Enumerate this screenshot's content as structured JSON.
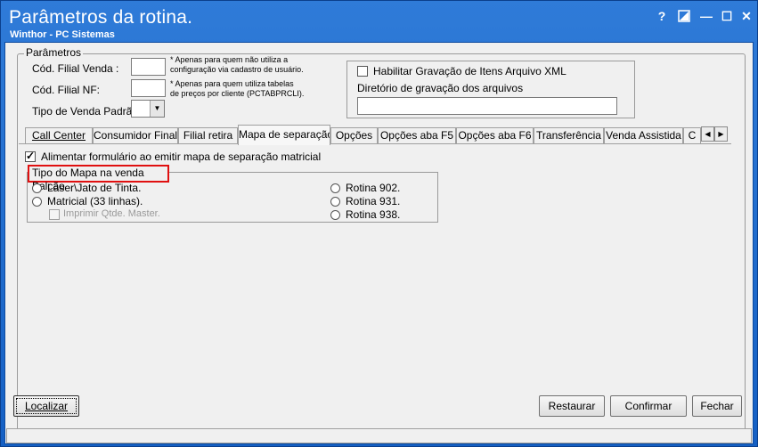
{
  "window": {
    "title": "Parâmetros da rotina.",
    "subtitle": "Winthor - PC Sistemas",
    "help_label": "?",
    "min_label": "—",
    "max_label": "☐",
    "close_label": "✕"
  },
  "params": {
    "group_title": "Parâmetros",
    "filial_venda_label": "Cód. Filial Venda :",
    "filial_venda_value": "",
    "filial_venda_note": [
      "* Apenas para quem não utiliza a",
      "configuração via cadastro de usuário."
    ],
    "filial_nf_label": "Cód. Filial NF:",
    "filial_nf_value": "",
    "filial_nf_note": [
      "* Apenas para quem utiliza tabelas",
      "de preços por cliente (PCTABPRCLI)."
    ],
    "tipo_venda_label": "Tipo de Venda Padrão:",
    "tipo_venda_value": ""
  },
  "xml": {
    "checkbox_label": "Habilitar Gravação de Itens Arquivo XML",
    "checked": false,
    "dir_label": "Diretório de gravação dos arquivos",
    "dir_value": ""
  },
  "tabs": [
    {
      "label": "Call Center",
      "active": false
    },
    {
      "label": "Consumidor Final",
      "active": false
    },
    {
      "label": "Filial retira",
      "active": false
    },
    {
      "label": "Mapa de separação",
      "active": true
    },
    {
      "label": "Opções",
      "active": false
    },
    {
      "label": "Opções aba F5",
      "active": false
    },
    {
      "label": "Opções aba F6",
      "active": false
    },
    {
      "label": "Transferência",
      "active": false
    },
    {
      "label": "Venda Assistida",
      "active": false
    },
    {
      "label": "C",
      "active": false
    }
  ],
  "mapa": {
    "alimentar_label": "Alimentar formulário ao emitir mapa de separação matricial",
    "alimentar_checked": true,
    "tipo_title": "Tipo do Mapa na venda Balcão",
    "options_left": [
      "Laser\\Jato de Tinta.",
      "Matricial (33 linhas)."
    ],
    "imprimir_label": "Imprimir Qtde. Master.",
    "options_right": [
      "Rotina 902.",
      "Rotina 931.",
      "Rotina 938."
    ]
  },
  "buttons": {
    "localizar": "Localizar",
    "restaurar": "Restaurar",
    "confirmar": "Confirmar",
    "fechar": "Fechar"
  },
  "status": {
    "text": ""
  },
  "colors": {
    "title_bar": "#2f7bd8",
    "highlight_border": "#e01010",
    "client_bg": "#f0f0f0"
  }
}
